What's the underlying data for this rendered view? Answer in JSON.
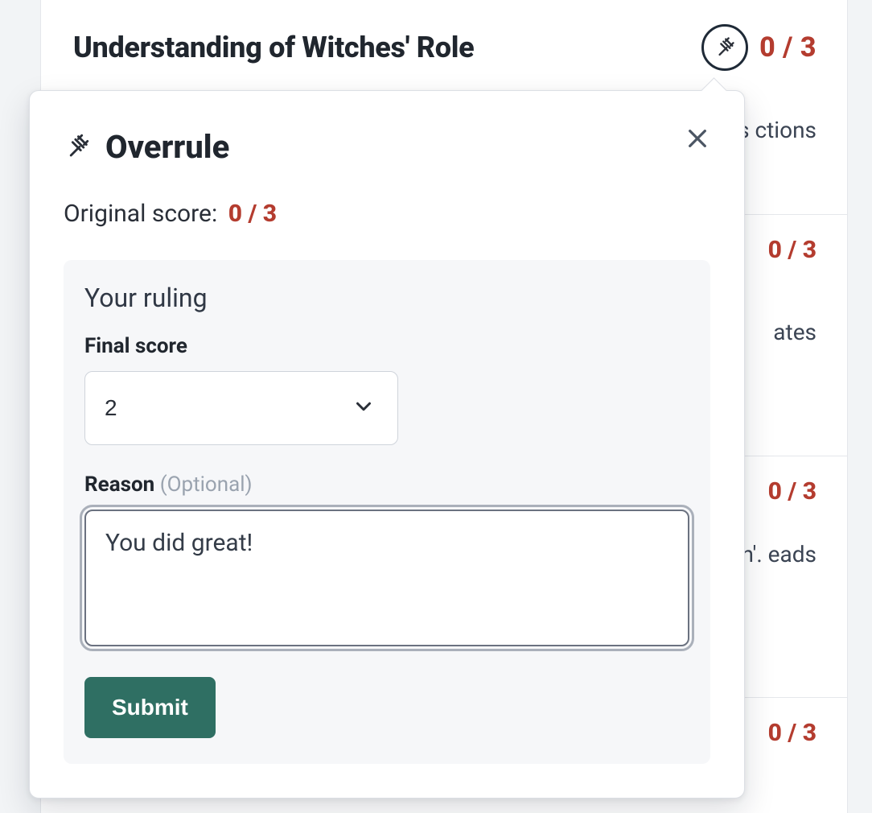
{
  "header": {
    "title": "Understanding of Witches' Role",
    "score": "0 / 3"
  },
  "subitems": [
    {
      "desc": "eth's ctions",
      "score": ""
    },
    {
      "desc": "ates",
      "score": "0 / 3"
    },
    {
      "desc": "eth'. eads",
      "score": "0 / 3"
    },
    {
      "desc": "",
      "score": "0 / 3"
    }
  ],
  "popover": {
    "title": "Overrule",
    "original_label": "Original score:",
    "original_score": "0 / 3",
    "ruling_title": "Your ruling",
    "final_score_label": "Final score",
    "final_score_value": "2",
    "reason_label": "Reason",
    "reason_optional": "(Optional)",
    "reason_value": "You did great!",
    "submit_label": "Submit"
  }
}
